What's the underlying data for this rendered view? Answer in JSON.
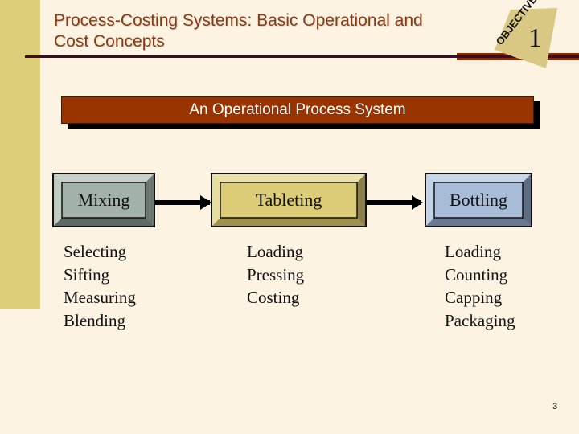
{
  "slide": {
    "title_line1": "Process-Costing Systems:  Basic Operational and",
    "title_line2": "Cost Concepts",
    "objective_badge": {
      "label": "OBJECTIVE",
      "number": "1"
    },
    "banner": "An Operational Process System",
    "stages": [
      {
        "name": "Mixing",
        "color": "#a3b2a8",
        "steps": [
          "Selecting",
          "Sifting",
          "Measuring",
          "Blending"
        ]
      },
      {
        "name": "Tableting",
        "color": "#ddcc77",
        "steps": [
          "Loading",
          "Pressing",
          "Costing"
        ]
      },
      {
        "name": "Bottling",
        "color": "#a8bcd8",
        "steps": [
          "Loading",
          "Counting",
          "Capping",
          "Packaging"
        ]
      }
    ],
    "page_number": "3"
  }
}
